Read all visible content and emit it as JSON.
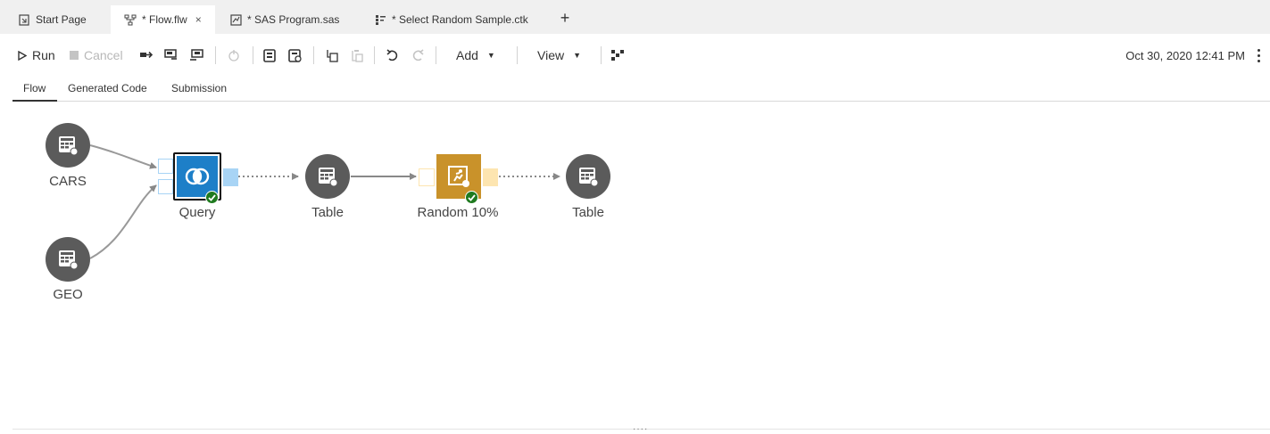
{
  "tabs": [
    {
      "label": "Start Page",
      "icon": "start-page-icon"
    },
    {
      "label": "* Flow.flw",
      "icon": "flow-icon",
      "active": true,
      "close": "×"
    },
    {
      "label": "* SAS Program.sas",
      "icon": "program-icon"
    },
    {
      "label": "* Select Random Sample.ctk",
      "icon": "task-icon"
    }
  ],
  "toolbar": {
    "run_label": "Run",
    "cancel_label": "Cancel",
    "add_label": "Add",
    "view_label": "View",
    "timestamp": "Oct 30, 2020 12:41 PM"
  },
  "subtabs": [
    "Flow",
    "Generated Code",
    "Submission"
  ],
  "flow": {
    "nodes": {
      "cars": "CARS",
      "geo": "GEO",
      "query": "Query",
      "table1": "Table",
      "random": "Random 10%",
      "table2": "Table"
    }
  },
  "colors": {
    "node_gray": "#5b5b5b",
    "query_blue": "#1d7fc8",
    "random_gold": "#c9922a",
    "status_green": "#1f7a1f",
    "port_blue": "#a8d4f5",
    "port_gold": "#fde5b0"
  }
}
